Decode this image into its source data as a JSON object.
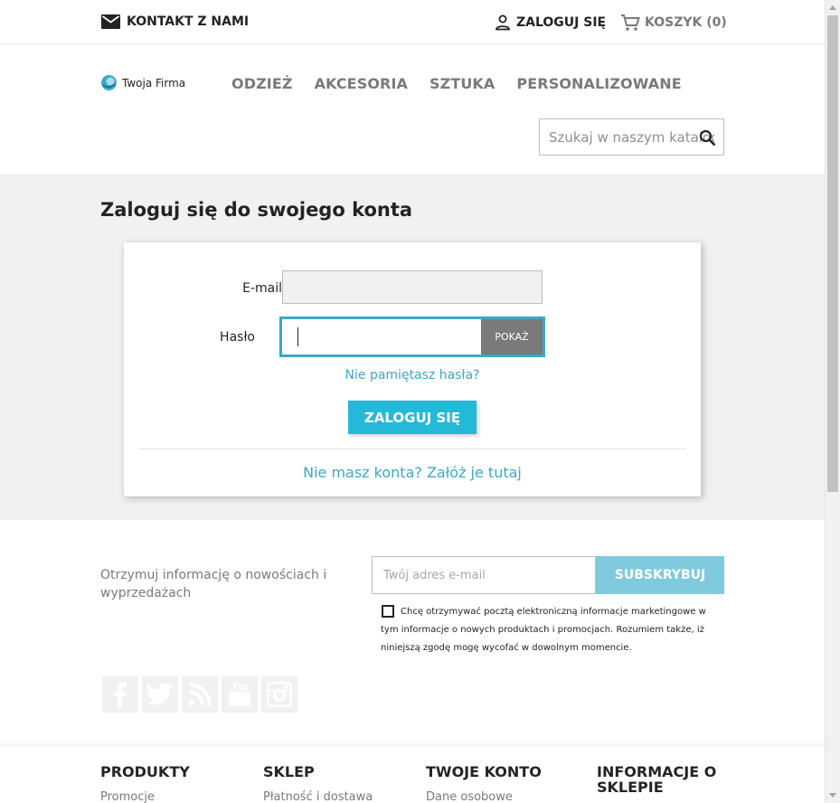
{
  "topbar": {
    "contact": "KONTAKT Z NAMI",
    "login": "ZALOGUJ SIĘ",
    "cart": "KOSZYK (0)"
  },
  "header": {
    "logo_text": "Twoja Firma",
    "nav": [
      "ODZIEŻ",
      "AKCESORIA",
      "SZTUKA",
      "PERSONALIZOWANE"
    ],
    "search_placeholder": "Szukaj w naszym katalogu"
  },
  "login": {
    "title": "Zaloguj się do swojego konta",
    "email_label": "E-mail",
    "email_value": "",
    "password_label": "Hasło",
    "password_value": "",
    "show_button": "POKAŻ",
    "forgot": "Nie pamiętasz hasła?",
    "submit": "ZALOGUJ SIĘ",
    "register": "Nie masz konta? Załóż je tutaj"
  },
  "newsletter": {
    "text": "Otrzymuj informację o nowościach i wyprzedażach",
    "placeholder": "Twój adres e-mail",
    "button": "SUBSKRYBUJ",
    "consent": "Chcę otrzymywać pocztą elektroniczną informacje marketingowe w tym informacje o nowych produktach i promocjach. Rozumiem także, iż niniejszą zgodę mogę wycofać w dowolnym momencie."
  },
  "socials": [
    "facebook-icon",
    "twitter-icon",
    "rss-icon",
    "youtube-icon",
    "instagram-icon"
  ],
  "footer": {
    "columns": [
      {
        "title": "PRODUKTY",
        "first_link": "Promocje"
      },
      {
        "title": "SKLEP",
        "first_link": "Płatność i dostawa"
      },
      {
        "title": "TWOJE KONTO",
        "first_link": "Dane osobowe"
      },
      {
        "title": "INFORMACJE O SKLEPIE",
        "first_link": ""
      }
    ]
  },
  "colors": {
    "accent": "#24b9d7",
    "link": "#3ba9c5",
    "background_gray": "#f1f1f1"
  }
}
